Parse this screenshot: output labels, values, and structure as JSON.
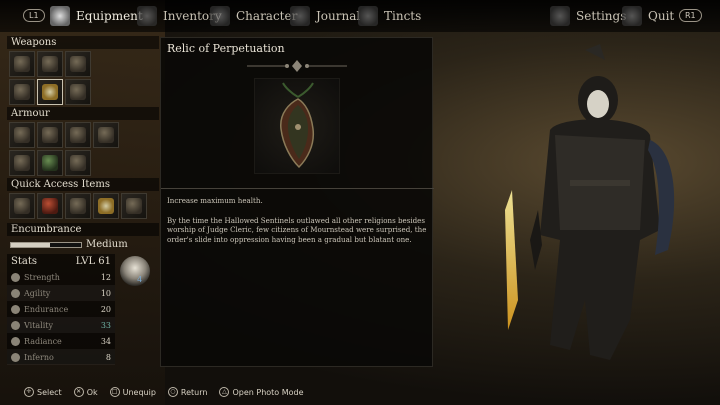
{
  "tabs": {
    "left_hint": "L1",
    "right_hint": "R1",
    "equipment": "Equipment",
    "inventory": "Inventory",
    "character": "Character",
    "journal": "Journal",
    "tincts": "Tincts",
    "settings": "Settings",
    "quit": "Quit",
    "active": "Equipment"
  },
  "left": {
    "weapons_title": "Weapons",
    "armour_title": "Armour",
    "quick_access_title": "Quick Access Items",
    "encumbrance_title": "Encumbrance",
    "encumbrance_label": "Medium",
    "encumbrance_fill_fraction": 0.55
  },
  "stats": {
    "title": "Stats",
    "level": "LVL 61",
    "rows": [
      {
        "name": "Strength",
        "value": "12"
      },
      {
        "name": "Agility",
        "value": "10"
      },
      {
        "name": "Endurance",
        "value": "20"
      },
      {
        "name": "Vitality",
        "value": "33"
      },
      {
        "name": "Radiance",
        "value": "34"
      },
      {
        "name": "Inferno",
        "value": "8"
      }
    ],
    "skull_badge": "4"
  },
  "item": {
    "title": "Relic of Perpetuation",
    "desc_line1": "Increase maximum health.",
    "desc_line2": "By the time the Hallowed Sentinels outlawed all other religions besides worship of Judge Cleric, few citizens of Mournstead were surprised, the order's slide into oppression having been a gradual but blatant one."
  },
  "footer": {
    "select": "Select",
    "ok": "Ok",
    "unequip": "Unequip",
    "return": "Return",
    "photo": "Open Photo Mode"
  },
  "colors": {
    "accent_text": "#e9e3d6",
    "teal_stat": "#6fb3a6"
  }
}
